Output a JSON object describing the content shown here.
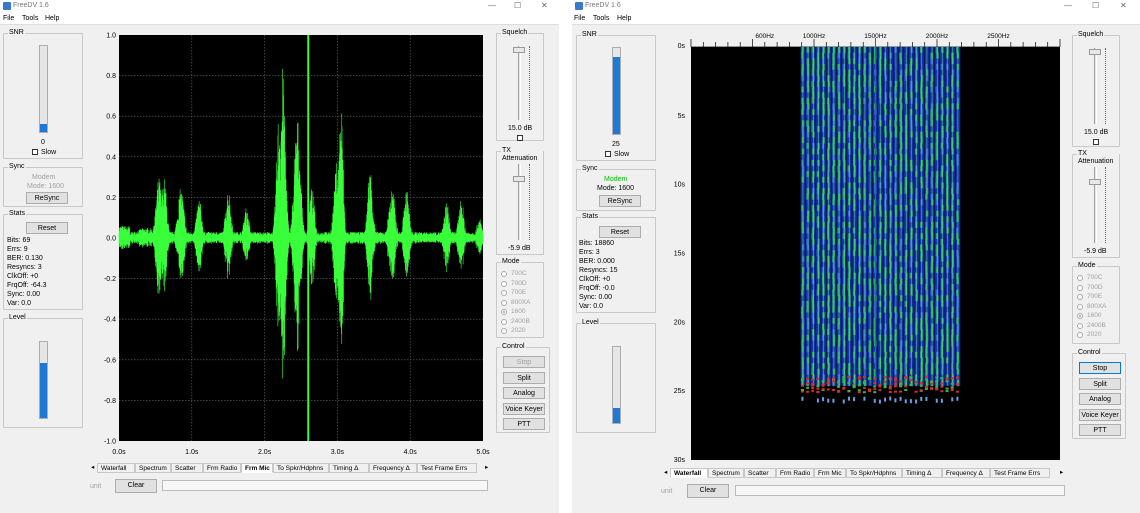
{
  "left_window": {
    "title": "FreeDV 1.6",
    "menu": [
      "File",
      "Tools",
      "Help"
    ],
    "snr": {
      "title": "SNR",
      "value": "0",
      "slow_label": "Slow",
      "level_pct": 9
    },
    "sync": {
      "title": "Sync",
      "status": "Modem",
      "mode": "Mode: 1600",
      "resync_label": "ReSync"
    },
    "stats": {
      "title": "Stats",
      "reset_label": "Reset",
      "lines": [
        "Bits: 69",
        "Errs: 9",
        "BER: 0.130",
        "Resyncs: 3",
        "ClkOff: +0",
        "FrqOff: -64.3",
        "Sync: 0.00",
        "Var:  0.0"
      ]
    },
    "level": {
      "title": "Level",
      "level_pct": 73
    },
    "squelch": {
      "title": "Squelch",
      "value": "15.0 dB"
    },
    "tx_atten": {
      "title": "TX Attenuation",
      "value": "-5.9 dB"
    },
    "mode": {
      "title": "Mode",
      "options": [
        "700C",
        "700D",
        "700E",
        "800XA",
        "1600",
        "2400B",
        "2020"
      ],
      "selected": "1600"
    },
    "control": {
      "title": "Control",
      "buttons": [
        "Stop",
        "Split",
        "Analog",
        "Voice Keyer",
        "PTT"
      ]
    },
    "tabs": [
      "Waterfall",
      "Spectrum",
      "Scatter",
      "Frm Radio",
      "Frm Mic",
      "To Spkr/Hdphns",
      "Timing Δ",
      "Frequency Δ",
      "Test Frame Errs"
    ],
    "active_tab": "Frm Mic",
    "bottom": {
      "unit_label": "unit",
      "clear_label": "Clear"
    },
    "plot": {
      "y_ticks": [
        "1.0",
        "0.8",
        "0.6",
        "0.4",
        "0.2",
        "0.0",
        "-0.2",
        "-0.4",
        "-0.6",
        "-0.8",
        "-1.0"
      ],
      "x_ticks": [
        "0.0s",
        "1.0s",
        "2.0s",
        "3.0s",
        "4.0s",
        "5.0s"
      ],
      "trace_color": "#39ff3a",
      "cursor_time_s": 2.6
    }
  },
  "right_window": {
    "title": "FreeDV 1.6",
    "menu": [
      "File",
      "Tools",
      "Help"
    ],
    "snr": {
      "title": "SNR",
      "value": "25",
      "slow_label": "Slow",
      "level_pct": 90
    },
    "sync": {
      "title": "Sync",
      "status": "Modem",
      "status_color": "#00c000",
      "mode": "Mode: 1600",
      "resync_label": "ReSync"
    },
    "stats": {
      "title": "Stats",
      "reset_label": "Reset",
      "lines": [
        "Bits: 18860",
        "Errs: 3",
        "BER: 0.000",
        "Resyncs: 15",
        "ClkOff: +0",
        "FrqOff: -0.0",
        "Sync: 0.00",
        "Var:  0.0"
      ]
    },
    "level": {
      "title": "Level",
      "level_pct": 20
    },
    "squelch": {
      "title": "Squelch",
      "value": "15.0 dB"
    },
    "tx_atten": {
      "title": "TX Attenuation",
      "value": "-5.9 dB"
    },
    "mode": {
      "title": "Mode",
      "options": [
        "700C",
        "700D",
        "700E",
        "800XA",
        "1600",
        "2400B",
        "2020"
      ],
      "selected": "1600"
    },
    "control": {
      "title": "Control",
      "buttons": [
        "Stop",
        "Split",
        "Analog",
        "Voice Keyer",
        "PTT"
      ]
    },
    "tabs": [
      "Waterfall",
      "Spectrum",
      "Scatter",
      "Frm Radio",
      "Frm Mic",
      "To Spkr/Hdphns",
      "Timing Δ",
      "Frequency Δ",
      "Test Frame Errs"
    ],
    "active_tab": "Waterfall",
    "bottom": {
      "unit_label": "unit",
      "clear_label": "Clear"
    },
    "waterfall": {
      "freq_labels": [
        "600Hz",
        "1000Hz",
        "1500Hz",
        "2000Hz",
        "2500Hz"
      ],
      "time_labels": [
        "0s",
        "5s",
        "10s",
        "15s",
        "20s",
        "25s",
        "30s"
      ],
      "marker_hz": 1500
    }
  }
}
